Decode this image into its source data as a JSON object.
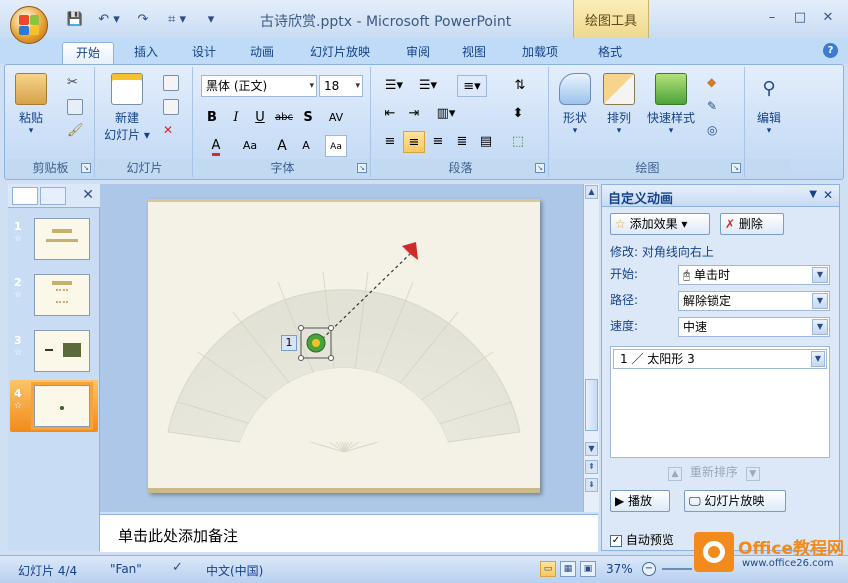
{
  "window": {
    "title": "古诗欣赏.pptx - Microsoft PowerPoint",
    "contextual_tab": "绘图工具",
    "minimize": "–",
    "maximize": "□",
    "close": "✕"
  },
  "qat": {
    "save": "💾",
    "undo": "↶ ▾",
    "redo": "↷",
    "preview": "⌗ ▾",
    "customize": "▾"
  },
  "ribbon_tabs": [
    "开始",
    "插入",
    "设计",
    "动画",
    "幻灯片放映",
    "审阅",
    "视图",
    "加载项",
    "格式"
  ],
  "ribbon": {
    "clipboard": {
      "label": "剪贴板",
      "paste": "粘贴"
    },
    "slides": {
      "label": "幻灯片",
      "new_slide_1": "新建",
      "new_slide_2": "幻灯片 ▾"
    },
    "font": {
      "label": "字体",
      "font_name": "黑体 (正文)",
      "font_size": "18",
      "bold": "B",
      "italic": "I",
      "underline": "U",
      "strike": "abc",
      "shadow": "S",
      "spacing": "AV",
      "font_color": "A",
      "case": "Aa",
      "grow": "A",
      "shrink": "A"
    },
    "paragraph": {
      "label": "段落"
    },
    "drawing": {
      "label": "绘图",
      "shape": "形状",
      "arrange": "排列",
      "quick_style": "快速样式"
    },
    "editing": {
      "label": "编辑"
    }
  },
  "slides_panel": {
    "close": "✕",
    "slides": [
      {
        "num": "1",
        "star": "☆"
      },
      {
        "num": "2",
        "star": "☆"
      },
      {
        "num": "3",
        "star": "☆"
      },
      {
        "num": "4",
        "star": "☆"
      }
    ]
  },
  "slide": {
    "anim_tag": "1"
  },
  "notes": {
    "placeholder": "单击此处添加备注"
  },
  "task_pane": {
    "title": "自定义动画",
    "add_effect": "添加效果 ▾",
    "remove": "删除",
    "modify": "修改: 对角线向右上",
    "start_label": "开始:",
    "start_value": "单击时",
    "path_label": "路径:",
    "path_value": "解除锁定",
    "speed_label": "速度:",
    "speed_value": "中速",
    "anim_item": "1   ／ 太阳形 3",
    "reorder": "重新排序",
    "play": "▶ 播放",
    "slideshow": "幻灯片放映",
    "autopreview": "自动预览"
  },
  "statusbar": {
    "slide_info": "幻灯片 4/4",
    "theme": "\"Fan\"",
    "language": "中文(中国)",
    "zoom": "37%"
  },
  "watermark": {
    "brand": "Office教程网",
    "url": "www.office26.com"
  },
  "colors": {
    "accent": "#f28b1b",
    "ribbon": "#cde0f7",
    "text": "#15428b"
  }
}
